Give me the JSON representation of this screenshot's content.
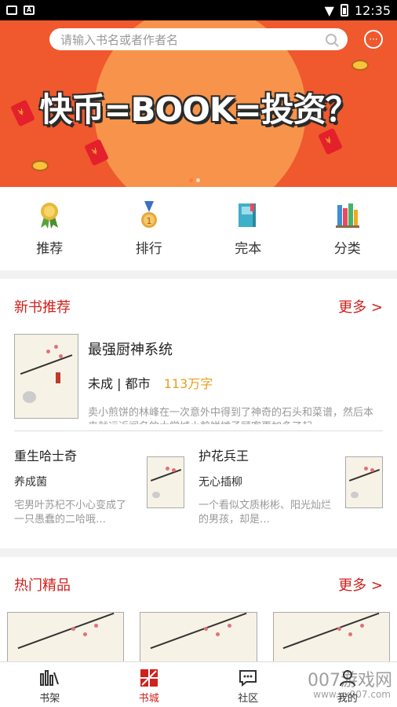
{
  "status_bar": {
    "time": "12:35"
  },
  "search": {
    "placeholder": "请输入书名或者作者名"
  },
  "banner": {
    "headline": "快币=BOOK=投资？"
  },
  "categories": [
    {
      "label": "推荐",
      "icon": "medal-icon"
    },
    {
      "label": "排行",
      "icon": "rank-medal-icon"
    },
    {
      "label": "完本",
      "icon": "book-icon"
    },
    {
      "label": "分类",
      "icon": "bookshelf-icon"
    }
  ],
  "new_books": {
    "title": "新书推荐",
    "more": "更多 >",
    "featured": {
      "title": "最强厨神系统",
      "status": "未成",
      "genre": "都市",
      "words": "113万字",
      "desc": "卖小煎饼的林峰在一次意外中得到了神奇的石头和菜谱，然后本来就远近闻名的大学城小煎饼摊子顾客更加多了起…"
    },
    "pair": [
      {
        "title": "重生哈士奇",
        "author": "养成菌",
        "desc": "宅男叶苏杞不小心变成了一只愚蠢的二哈哦…"
      },
      {
        "title": "护花兵王",
        "author": "无心插柳",
        "desc": "一个看似文质彬彬、阳光灿烂的男孩，却是…"
      }
    ]
  },
  "hot_books": {
    "title": "热门精品",
    "more": "更多 >"
  },
  "tabs": [
    {
      "label": "书架",
      "icon": "bookshelf-tab-icon"
    },
    {
      "label": "书城",
      "icon": "bookstore-tab-icon",
      "active": true
    },
    {
      "label": "社区",
      "icon": "chat-tab-icon"
    },
    {
      "label": "我的",
      "icon": "user-tab-icon"
    }
  ],
  "watermark": {
    "text": "007游戏网",
    "url": "www.yx007.com"
  },
  "colors": {
    "accent": "#d0211c",
    "banner_bg": "#f0582e",
    "words_color": "#e5a020"
  }
}
